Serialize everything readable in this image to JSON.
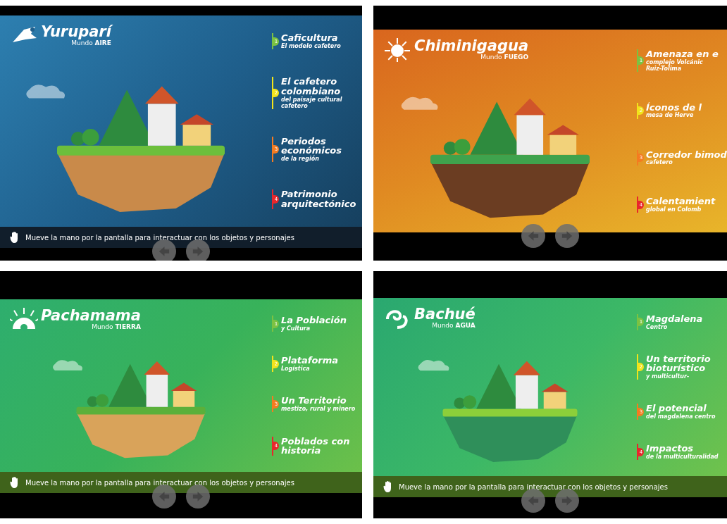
{
  "panels": [
    {
      "kind": "air",
      "title": "Yuruparí",
      "subtitle": "Mundo **AIRE**",
      "menu": [
        {
          "number": "1",
          "title": "Caficultura",
          "detail": "El modelo cafetero",
          "color": "#7cc242"
        },
        {
          "number": "2",
          "title": "El cafetero colombiano",
          "detail": "del paisaje cultural cafetero",
          "color": "#f2e31b"
        },
        {
          "number": "3",
          "title": "Periodos económicos",
          "detail": "de la región",
          "color": "#f47b20"
        },
        {
          "number": "4",
          "title": "Patrimonio arquitectónico",
          "color": "#e8262b"
        }
      ],
      "hint": "Mueve la mano por la pantalla para interactuar con los objetos y personajes"
    },
    {
      "kind": "fire",
      "title": "Chiminigagua",
      "subtitle": "Mundo **FUEGO**",
      "menu": [
        {
          "number": "1",
          "title": "Amenaza en e",
          "detail": "complejo Volcánic",
          "detail_2": "Ruiz-Tolima",
          "color": "#7cc242"
        },
        {
          "number": "2",
          "title": "Íconos de l",
          "detail": "mesa de Herve",
          "color": "#f2e31b"
        },
        {
          "number": "3",
          "title": "Corredor bimod",
          "detail": "cafetero",
          "color": "#f47b20"
        },
        {
          "number": "4",
          "title": "Calentamient",
          "detail": "global en Colomb",
          "color": "#e8262b"
        }
      ]
    },
    {
      "kind": "earth",
      "title": "Pachamama",
      "subtitle": "Mundo **TIERRA**",
      "menu": [
        {
          "number": "1",
          "title": "La Población",
          "detail": "y Cultura",
          "color": "#7cc242"
        },
        {
          "number": "2",
          "title": "Plataforma",
          "detail": "Logística",
          "color": "#f2e31b"
        },
        {
          "number": "3",
          "title": "Un Territorio",
          "detail": "mestizo, rural y minero",
          "color": "#f47b20"
        },
        {
          "number": "4",
          "title": "Poblados con historia",
          "color": "#e8262b"
        }
      ],
      "hint": "Mueve la mano por la pantalla para interactuar con los objetos y personajes"
    },
    {
      "kind": "water",
      "title": "Bachué",
      "subtitle": "Mundo **AGUA**",
      "menu": [
        {
          "number": "1",
          "title": "Magdalena",
          "detail": "Centro",
          "color": "#7cc242"
        },
        {
          "number": "2",
          "title": "Un territorio bioturístico",
          "detail": "y multicultur-",
          "color": "#f2e31b"
        },
        {
          "number": "3",
          "title": "El potencial",
          "detail": "del magdalena centro",
          "color": "#f47b20"
        },
        {
          "number": "4",
          "title": "Impactos",
          "detail": "de la multiculturalidad",
          "color": "#e8262b"
        }
      ],
      "hint": "Mueve la mano por la pantalla para interactuar con los objetos y personajes"
    }
  ]
}
